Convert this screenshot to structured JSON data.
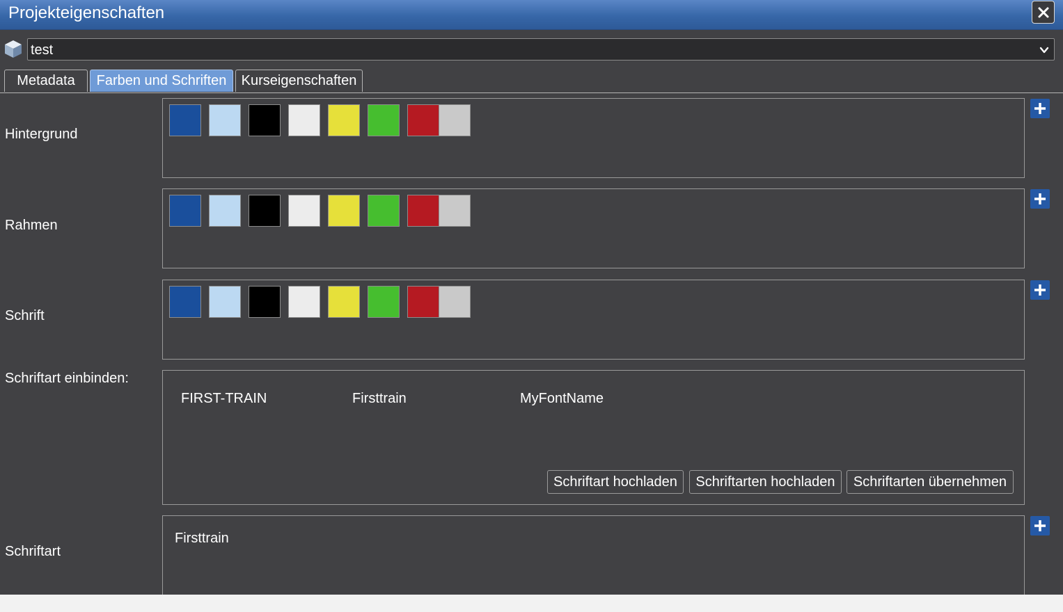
{
  "window": {
    "title": "Projekteigenschaften",
    "close_glyph": "✕"
  },
  "project": {
    "selected": "test",
    "icon": "cube-icon",
    "dropdown_icon": "chevron-down-icon"
  },
  "tabs": [
    {
      "label": "Metadata",
      "active": false
    },
    {
      "label": "Farben und Schriften",
      "active": true
    },
    {
      "label": "Kurseigenschaften",
      "active": false
    }
  ],
  "palette": [
    "#1a4f9c",
    "#bcd9f2",
    "#000000",
    "#ececec",
    "#e6e03a",
    "#46be2f",
    "#b51a22",
    "#c9c9c9"
  ],
  "sections": {
    "background": {
      "label": "Hintergrund"
    },
    "border": {
      "label": "Rahmen"
    },
    "font_color": {
      "label": "Schrift"
    },
    "embed": {
      "label": "Schriftart einbinden:",
      "fonts": [
        "FIRST-TRAIN",
        "Firsttrain",
        "MyFontName"
      ],
      "buttons": {
        "upload_one": "Schriftart hochladen",
        "upload_many": "Schriftarten hochladen",
        "apply": "Schriftarten übernehmen"
      }
    },
    "font": {
      "label": "Schriftart",
      "value": "Firsttrain"
    }
  },
  "add_icon": "plus-icon"
}
